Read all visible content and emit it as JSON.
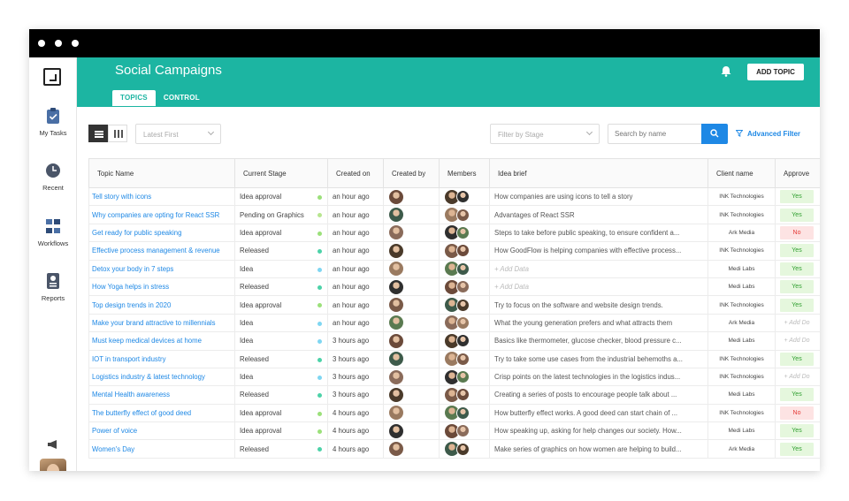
{
  "window_dots": 3,
  "sidebar": {
    "items": [
      {
        "label": "My Tasks",
        "icon": "clipboard-check-icon"
      },
      {
        "label": "Recent",
        "icon": "clock-icon"
      },
      {
        "label": "Workflows",
        "icon": "workflow-icon"
      },
      {
        "label": "Reports",
        "icon": "report-icon"
      }
    ]
  },
  "header": {
    "title": "Social Campaigns",
    "tabs": [
      "TOPICS",
      "CONTROL"
    ],
    "active_tab": 0,
    "add_button": "ADD TOPIC"
  },
  "toolbar": {
    "sort_value": "Latest First",
    "stage_filter_placeholder": "Filter by Stage",
    "search_placeholder": "Search by name",
    "advanced_filter": "Advanced Filter"
  },
  "table": {
    "headers": [
      "Topic Name",
      "Current Stage",
      "Created on",
      "Created by",
      "Members",
      "Idea brief",
      "Client name",
      "Approve"
    ],
    "rows": [
      {
        "topic": "Tell story with icons",
        "stage": "Idea approval",
        "created": "an hour ago",
        "idea": "How companies are using icons to tell a story",
        "client": "INK Technologies",
        "approve": "Yes"
      },
      {
        "topic": "Why companies are opting for React SSR",
        "stage": "Pending on Graphics",
        "created": "an hour ago",
        "idea": "Advantages of React SSR",
        "client": "INK Technologies",
        "approve": "Yes"
      },
      {
        "topic": "Get ready for public speaking",
        "stage": "Idea approval",
        "created": "an hour ago",
        "idea": "Steps to take before public speaking, to ensure confident a...",
        "client": "Ark Media",
        "approve": "No"
      },
      {
        "topic": "Effective process management & revenue",
        "stage": "Released",
        "created": "an hour ago",
        "idea": "How GoodFlow is helping companies with effective process...",
        "client": "INK Technologies",
        "approve": "Yes"
      },
      {
        "topic": "Detox your body in 7 steps",
        "stage": "Idea",
        "created": "an hour ago",
        "idea": "+ Add Data",
        "client": "Medi Labs",
        "approve": "Yes"
      },
      {
        "topic": "How Yoga helps in stress",
        "stage": "Released",
        "created": "an hour ago",
        "idea": "+ Add Data",
        "client": "Medi Labs",
        "approve": "Yes"
      },
      {
        "topic": "Top design trends in 2020",
        "stage": "Idea approval",
        "created": "an hour ago",
        "idea": "Try to focus on the software and website design trends.",
        "client": "INK Technologies",
        "approve": "Yes"
      },
      {
        "topic": "Make your brand attractive to millennials",
        "stage": "Idea",
        "created": "an hour ago",
        "idea": "What the young generation prefers and what attracts them",
        "client": "Ark Media",
        "approve": "+ Add Do"
      },
      {
        "topic": "Must keep medical devices at home",
        "stage": "Idea",
        "created": "3 hours ago",
        "idea": "Basics like thermometer, glucose checker, blood pressure c...",
        "client": "Medi Labs",
        "approve": "+ Add Do"
      },
      {
        "topic": "IOT in transport industry",
        "stage": "Released",
        "created": "3 hours ago",
        "idea": "Try to take some use cases from the industrial behemoths a...",
        "client": "INK Technologies",
        "approve": "Yes"
      },
      {
        "topic": "Logistics industry & latest technology",
        "stage": "Idea",
        "created": "3 hours ago",
        "idea": "Crisp points on the latest technologies in the logistics indus...",
        "client": "INK Technologies",
        "approve": "+ Add Do"
      },
      {
        "topic": "Mental Health awareness",
        "stage": "Released",
        "created": "3 hours ago",
        "idea": "Creating a series of posts to encourage people talk about ...",
        "client": "Medi Labs",
        "approve": "Yes"
      },
      {
        "topic": "The butterfly effect of good deed",
        "stage": "Idea approval",
        "created": "4 hours ago",
        "idea": "How butterfly effect works. A good deed can start chain of ...",
        "client": "INK Technologies",
        "approve": "No"
      },
      {
        "topic": "Power of voice",
        "stage": "Idea approval",
        "created": "4 hours ago",
        "idea": "How speaking up, asking for help changes our society. How...",
        "client": "Medi Labs",
        "approve": "Yes"
      },
      {
        "topic": "Women's Day",
        "stage": "Released",
        "created": "4 hours ago",
        "idea": "Make series of graphics on how women are helping to build...",
        "client": "Ark Media",
        "approve": "Yes"
      }
    ]
  },
  "colors": {
    "header": "#1cb5a2",
    "link": "#1e88e5",
    "stage_idea_approval": "#9be07a",
    "stage_released": "#4cd2a8",
    "stage_idea": "#7fd6f2",
    "stage_pending": "#b7e58f"
  }
}
